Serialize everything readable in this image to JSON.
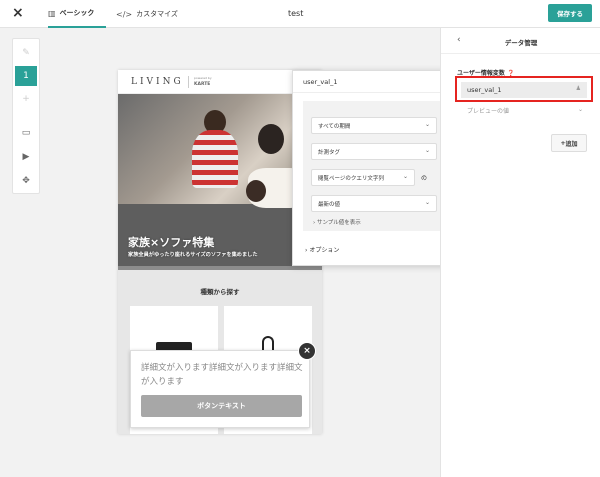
{
  "header": {
    "close_icon": "×",
    "tab_basic_label": "ベーシック",
    "tab_basic_icon": "panel-icon",
    "tab_custom_label": "カスタマイズ",
    "tab_custom_icon": "</>",
    "doc_title": "test",
    "save_label": "保存する",
    "accent_color": "#2aa198"
  },
  "toolbar": {
    "items": [
      "edit-icon",
      "layer-1",
      "add-icon",
      "devices-icon",
      "preview-icon",
      "expand-icon"
    ],
    "active_label": "1"
  },
  "preview": {
    "logo": "LIVING",
    "powered_by": "powered by",
    "karte": "KARTE",
    "hero_title": "家族×ソファ特集",
    "hero_subtitle": "家族全員がゆったり座れるサイズのソファを集めました",
    "category_title": "種類から探す"
  },
  "popup": {
    "body": "詳細文が入ります詳細文が入ります詳細文が入ります",
    "button_label": "ボタンテキスト",
    "close_icon": "×"
  },
  "variable_modal": {
    "title": "user_val_1",
    "close_icon": "×",
    "period_label": "すべての期間",
    "tag_label": "計測タグ",
    "query_label": "閲覧ページのクエリ文字列",
    "query_suffix": "の",
    "value_label": "最新の値",
    "sample_link": "サンプル値を表示",
    "options_link": "オプション"
  },
  "right_panel": {
    "back_icon": "‹",
    "title": "データ管理",
    "user_var_label": "ユーザー情報変数",
    "user_var_value": "user_val_1",
    "preview_placeholder": "プレビューの値",
    "add_label": "追加",
    "highlight_color": "#e52420"
  }
}
